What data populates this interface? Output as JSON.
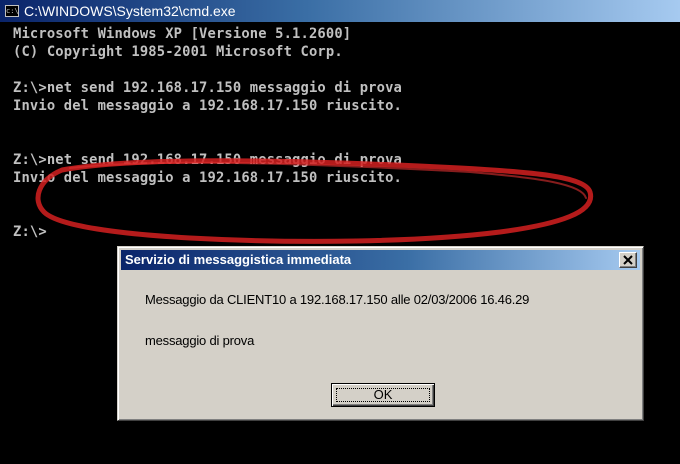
{
  "cmd_window": {
    "title": "C:\\WINDOWS\\System32\\cmd.exe",
    "title_icon": "cmd-icon",
    "lines": [
      "Microsoft Windows XP [Versione 5.1.2600]",
      "(C) Copyright 1985-2001 Microsoft Corp.",
      "",
      "Z:\\>net send 192.168.17.150 messaggio di prova",
      "Invio del messaggio a 192.168.17.150 riuscito.",
      "",
      "",
      "Z:\\>net send 192.168.17.150 messaggio di prova",
      "Invio del messaggio a 192.168.17.150 riuscito.",
      "",
      "",
      "Z:\\>"
    ]
  },
  "dialog": {
    "title": "Servizio di messaggistica immediata",
    "header_line": "Messaggio da CLIENT10 a 192.168.17.150 alle 02/03/2006 16.46.29",
    "message": "messaggio di prova",
    "ok_label": "OK",
    "close_icon": "close-icon"
  },
  "colors": {
    "console_bg": "#000000",
    "console_text": "#c0c0c0",
    "dialog_bg": "#d4d0c8",
    "title_active": "#0a246a",
    "annotation": "#d42020"
  }
}
